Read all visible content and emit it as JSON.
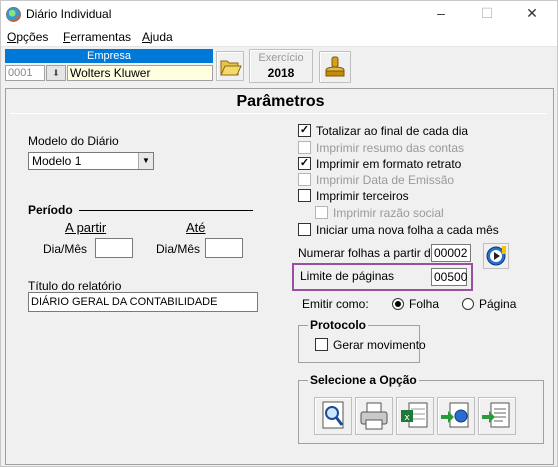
{
  "window": {
    "title": "Diário Individual"
  },
  "menu": [
    {
      "key": "O",
      "rest": "pções"
    },
    {
      "key": "F",
      "rest": "erramentas"
    },
    {
      "key": "A",
      "rest": "juda"
    }
  ],
  "toolbar": {
    "empresa_header": "Empresa",
    "empresa_code": "0001",
    "empresa_name": "Wolters Kluwer",
    "exercicio_label": "Exercício",
    "exercicio_value": "2018"
  },
  "panel": {
    "title": "Parâmetros",
    "modelo_label": "Modelo do Diário",
    "modelo_value": "Modelo 1",
    "periodo_label": "Período",
    "a_partir_label": "A partir",
    "ate_label": "Até",
    "dia_mes_label_1": "Dia/Mês",
    "dia_mes_label_2": "Dia/Mês",
    "dia_mes_from_value": "",
    "dia_mes_to_value": "",
    "titulo_label": "Título do relatório",
    "titulo_value": "DIÁRIO GERAL DA CONTABILIDADE"
  },
  "options": [
    {
      "label": "Totalizar ao final de cada dia",
      "checked": true,
      "disabled": false
    },
    {
      "label": "Imprimir resumo das contas",
      "checked": false,
      "disabled": true
    },
    {
      "label": "Imprimir em formato retrato",
      "checked": true,
      "disabled": false
    },
    {
      "label": "Imprimir Data de Emissão",
      "checked": false,
      "disabled": true
    },
    {
      "label": "Imprimir terceiros",
      "checked": false,
      "disabled": false
    },
    {
      "label": "Imprimir razão social",
      "checked": false,
      "disabled": true
    },
    {
      "label": "Iniciar uma nova folha a cada mês",
      "checked": false,
      "disabled": false
    }
  ],
  "numeracao": {
    "label": "Numerar folhas a partir de:",
    "value": "00002",
    "limite_label": "Limite de páginas",
    "limite_value": "00500"
  },
  "emitir": {
    "label": "Emitir como:",
    "folha_label": "Folha",
    "pagina_label": "Página",
    "selected": "Folha"
  },
  "protocolo": {
    "title": "Protocolo",
    "gerar_label": "Gerar movimento",
    "gerar_checked": false
  },
  "selecione": {
    "title": "Selecione a Opção",
    "buttons": [
      "preview-icon",
      "printer-icon",
      "excel-export-icon",
      "html-export-icon",
      "text-export-icon"
    ]
  },
  "colors": {
    "accent": "#0078d7",
    "highlight": "#9b4fa3",
    "input_bg_yellow": "#fffee0"
  }
}
